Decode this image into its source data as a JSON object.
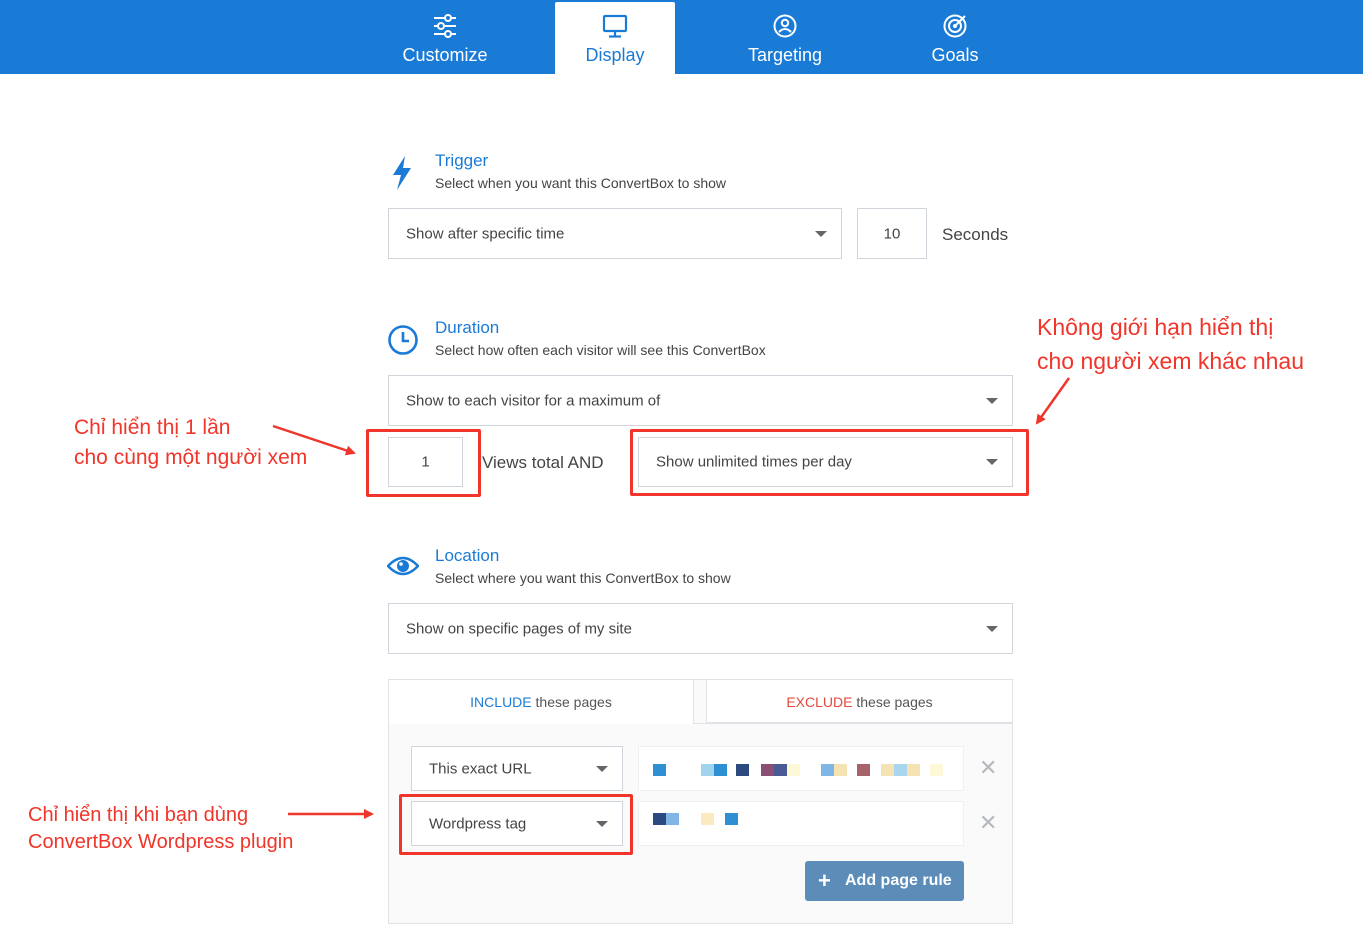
{
  "tabs": [
    {
      "label": "Customize",
      "icon": "sliders-icon",
      "active": false
    },
    {
      "label": "Display",
      "icon": "monitor-icon",
      "active": true
    },
    {
      "label": "Targeting",
      "icon": "user-target-icon",
      "active": false
    },
    {
      "label": "Goals",
      "icon": "target-icon",
      "active": false
    }
  ],
  "trigger": {
    "title": "Trigger",
    "description": "Select when you want this ConvertBox to show",
    "select_value": "Show after specific time",
    "seconds_value": "10",
    "seconds_label": "Seconds"
  },
  "duration": {
    "title": "Duration",
    "description": "Select how often each visitor will see this ConvertBox",
    "select_value": "Show to each visitor for a maximum of",
    "views_value": "1",
    "views_label": "Views total AND",
    "per_day_value": "Show unlimited times per day"
  },
  "location": {
    "title": "Location",
    "description": "Select where you want this ConvertBox to show",
    "select_value": "Show on specific pages of my site",
    "include_tab": {
      "keyword": "INCLUDE",
      "rest": " these pages"
    },
    "exclude_tab": {
      "keyword": "EXCLUDE",
      "rest": " these pages"
    },
    "rules": [
      {
        "type": "This exact URL"
      },
      {
        "type": "Wordpress tag"
      }
    ],
    "add_rule_label": "Add page rule"
  },
  "annotations": {
    "once_line1": "Chỉ hiển thị 1 lần",
    "once_line2": "cho cùng một người xem",
    "unlimited_line1": "Không giới hạn hiển thị",
    "unlimited_line2": "cho người xem khác nhau",
    "plugin_line1": "Chỉ hiển thị khi bạn dùng",
    "plugin_line2": "ConvertBox Wordpress plugin"
  },
  "colors": {
    "brand_blue": "#1a7bd6",
    "annotation_red": "#f0352a",
    "button_blue": "#5b8db8"
  }
}
